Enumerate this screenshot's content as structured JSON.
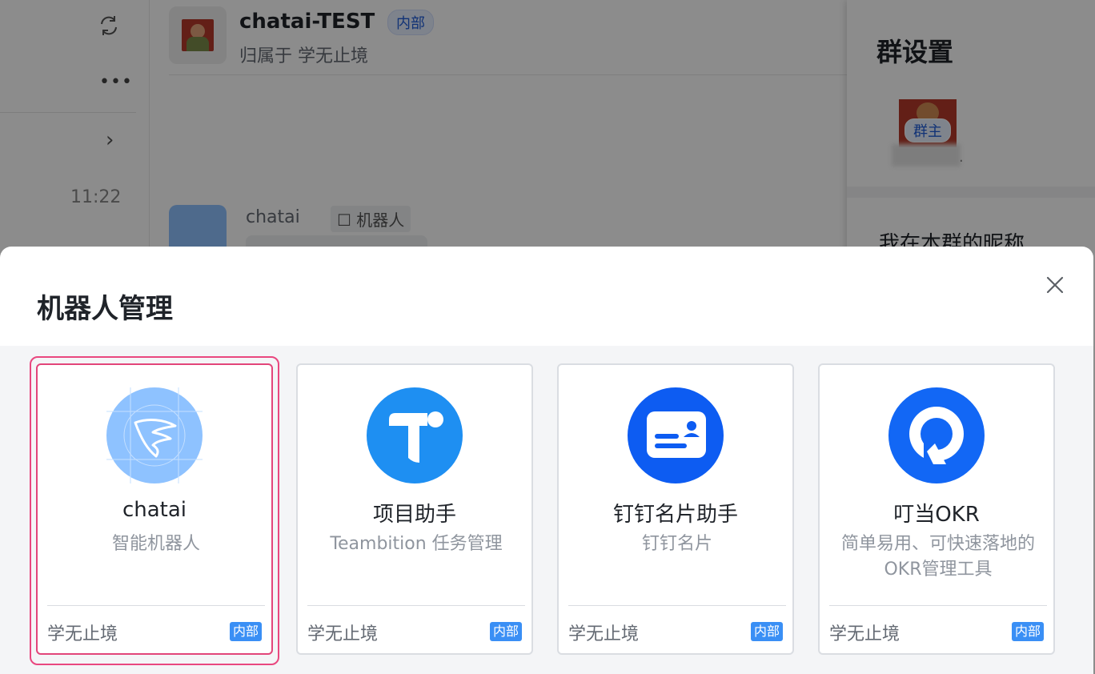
{
  "sidebar": {
    "time": "11:22"
  },
  "chat": {
    "title": "chatai-TEST",
    "badge": "内部",
    "subtitle": "归属于 学无止境",
    "message": {
      "sender": "chatai",
      "sender_tag": "机器人"
    }
  },
  "group_settings": {
    "title": "群设置",
    "owner_badge": "群主",
    "owner_name_suffix": ".",
    "nickname_label": "我在本群的昵称"
  },
  "modal": {
    "title": "机器人管理",
    "selected_index": 0,
    "cards": [
      {
        "name": "chatai",
        "desc": "智能机器人",
        "org": "学无止境",
        "badge": "内部",
        "icon": "chatai-logo-icon",
        "color": "#8ec2ff"
      },
      {
        "name": "项目助手",
        "desc": "Teambition 任务管理",
        "org": "学无止境",
        "badge": "内部",
        "icon": "teambition-logo-icon",
        "color": "#1e8ff2"
      },
      {
        "name": "钉钉名片助手",
        "desc": "钉钉名片",
        "org": "学无止境",
        "badge": "内部",
        "icon": "business-card-icon",
        "color": "#0d5cf2"
      },
      {
        "name": "叮当OKR",
        "desc": "简单易用、可快速落地的OKR管理工具",
        "org": "学无止境",
        "badge": "内部",
        "icon": "okr-logo-icon",
        "color": "#1267f5"
      }
    ]
  }
}
